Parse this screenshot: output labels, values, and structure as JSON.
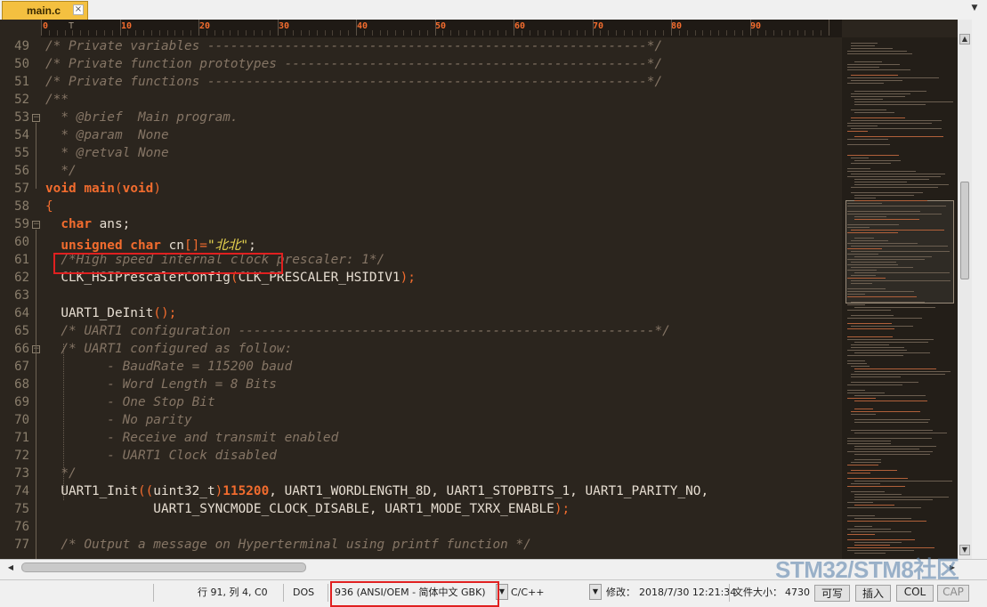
{
  "tab": {
    "label": "main.c",
    "close_glyph": "×"
  },
  "ruler": {
    "caret": "T",
    "marks": [
      "0",
      "10",
      "20",
      "30",
      "40",
      "50",
      "60",
      "70",
      "80",
      "90"
    ]
  },
  "editor": {
    "line_numbers": [
      "49",
      "50",
      "51",
      "52",
      "53",
      "54",
      "55",
      "56",
      "57",
      "58",
      "59",
      "60",
      "61",
      "62",
      "63",
      "64",
      "65",
      "66",
      "67",
      "68",
      "69",
      "70",
      "71",
      "72",
      "73",
      "74",
      "75",
      "76",
      "77"
    ]
  },
  "code": {
    "l49": "/* Private variables ---------------------------------------------------------*/",
    "l50": "/* Private function prototypes -----------------------------------------------*/",
    "l51": "/* Private functions ---------------------------------------------------------*/",
    "l52": "/**",
    "l53": "  * @brief  Main program.",
    "l54": "  * @param  None",
    "l55": "  * @retval None",
    "l56": "  */",
    "l57_kw": "void",
    "l57_id": " main",
    "l57_p1": "(",
    "l57_arg": "void",
    "l57_p2": ")",
    "l58": "{",
    "l59_indent": "  ",
    "l59_kw": "char",
    "l59_rest": " ans;",
    "l60_indent": "  ",
    "l60_kw": "unsigned char",
    "l60_id": " cn",
    "l60_p": "[]=",
    "l60_str": "\"北北\"",
    "l60_end": ";",
    "l61": "  /*High speed internal clock prescaler: 1*/",
    "l62_id": "  CLK_HSIPrescalerConfig",
    "l62_p1": "(",
    "l62_arg": "CLK_PRESCALER_HSIDIV1",
    "l62_p2": ");",
    "l64_id": "  UART1_DeInit",
    "l64_p": "();",
    "l65": "  /* UART1 configuration ------------------------------------------------------*/",
    "l66": "  /* UART1 configured as follow:",
    "l67": "        - BaudRate = 115200 baud",
    "l68": "        - Word Length = 8 Bits",
    "l69": "        - One Stop Bit",
    "l70": "        - No parity",
    "l71": "        - Receive and transmit enabled",
    "l72": "        - UART1 Clock disabled",
    "l73": "  */",
    "l74_id": "  UART1_Init",
    "l74_p1": "((",
    "l74_cast": "uint32_t",
    "l74_p2": ")",
    "l74_num": "115200",
    "l74_rest": ", UART1_WORDLENGTH_8D, UART1_STOPBITS_1, UART1_PARITY_NO,",
    "l75_id": "              UART1_SYNCMODE_CLOCK_DISABLE, UART1_MODE_TXRX_ENABLE",
    "l75_p": ");",
    "l77": "  /* Output a message on Hyperterminal using printf function */"
  },
  "status": {
    "position": "行 91, 列 4, C0",
    "eol": "DOS",
    "encoding": "936  (ANSI/OEM - 简体中文 GBK)",
    "language": "C/C++",
    "modified_label": "修改：",
    "modified_value": "2018/7/30 12:21:34",
    "filesize_label": "文件大小：",
    "filesize_value": "4730",
    "btn_rw": "可写",
    "btn_insert": "插入",
    "btn_col": "COL",
    "btn_cap": "CAP"
  },
  "watermark": "STM32/STM8社区",
  "icons": {
    "dropdown": "▼",
    "scroll_up": "▲",
    "scroll_down": "▼",
    "scroll_left": "◀",
    "scroll_right": "▶",
    "fold": "−"
  },
  "colors": {
    "editor_bg": "#2b251e",
    "keyword": "#f26c2e",
    "comment": "#857565",
    "string": "#e9d54f",
    "tab_active": "#f4c040",
    "highlight_box": "#e02020"
  }
}
